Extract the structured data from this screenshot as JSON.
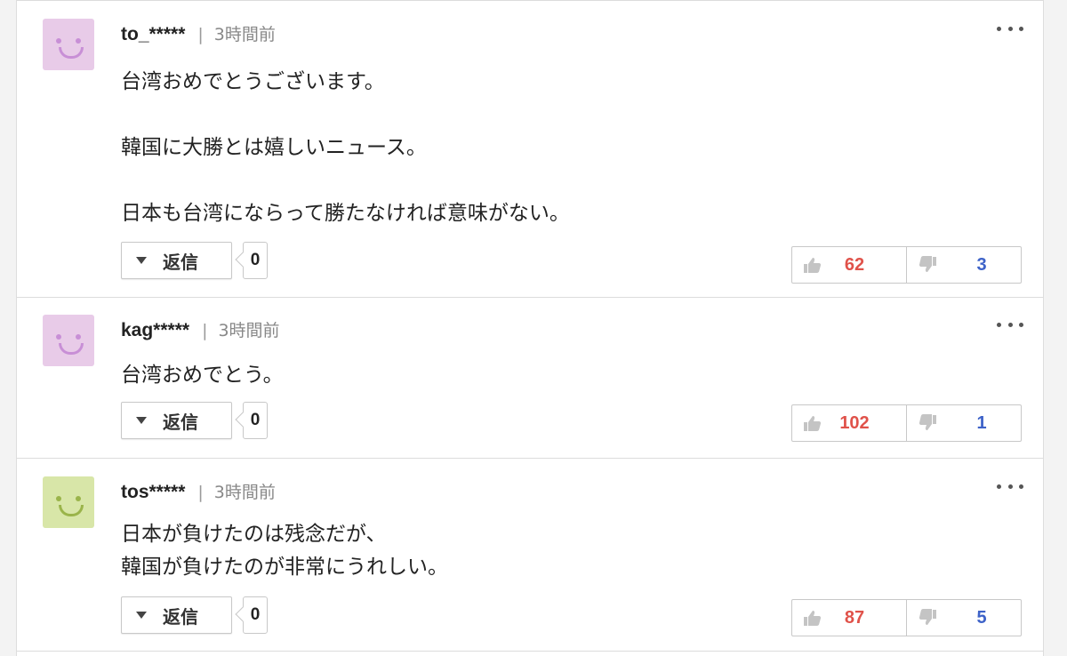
{
  "colors": {
    "like": "#e0524a",
    "dislike": "#3d62c8"
  },
  "comments": [
    {
      "user": "to_*****",
      "separator": "|",
      "time": "3時間前",
      "avatar": {
        "bg": "#e8cbe8",
        "face": "#c88fd6",
        "icon": "smiley-icon"
      },
      "text": "台湾おめでとうございます。\n\n韓国に大勝とは嬉しいニュース。\n\n日本も台湾にならって勝たなければ意味がない。",
      "reply_label": "返信",
      "reply_count": "0",
      "likes": "62",
      "dislikes": "3"
    },
    {
      "user": "kag*****",
      "separator": "|",
      "time": "3時間前",
      "avatar": {
        "bg": "#e8cbe8",
        "face": "#c88fd6",
        "icon": "smiley-icon"
      },
      "text": "台湾おめでとう。",
      "reply_label": "返信",
      "reply_count": "0",
      "likes": "102",
      "dislikes": "1"
    },
    {
      "user": "tos*****",
      "separator": "|",
      "time": "3時間前",
      "avatar": {
        "bg": "#d8e6a8",
        "face": "#9ab44a",
        "icon": "smiley-icon"
      },
      "text": "日本が負けたのは残念だが、\n韓国が負けたのが非常にうれしい。",
      "reply_label": "返信",
      "reply_count": "0",
      "likes": "87",
      "dislikes": "5"
    }
  ]
}
